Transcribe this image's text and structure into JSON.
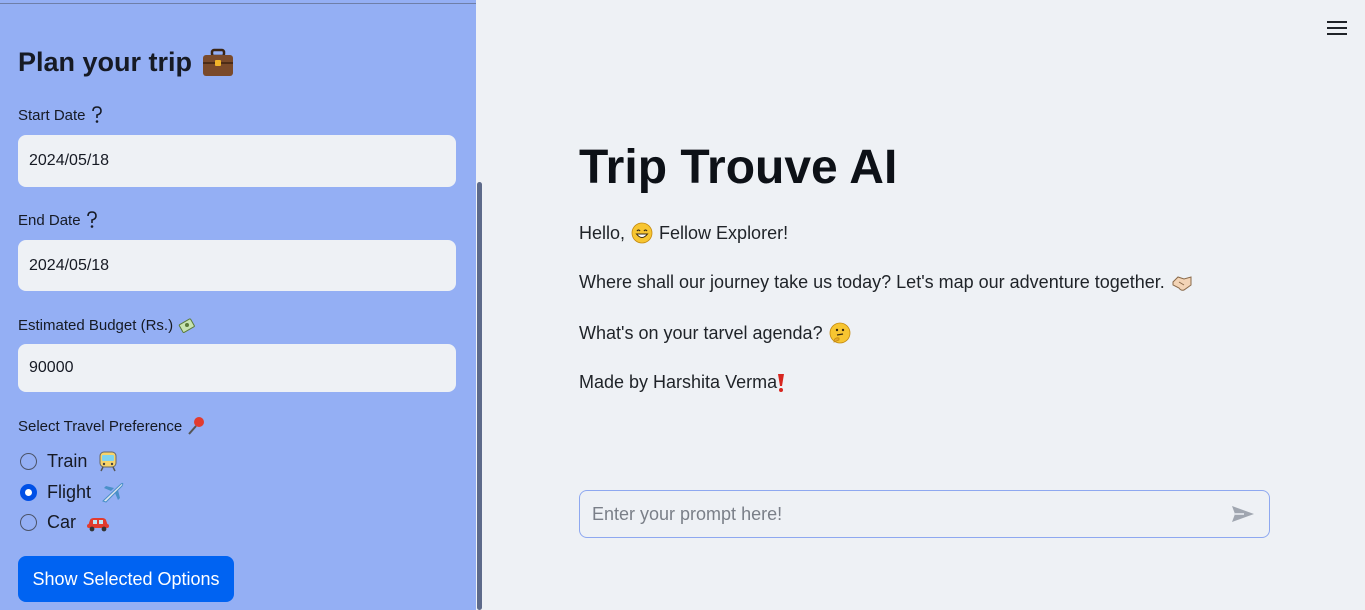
{
  "sidebar": {
    "title": "Plan your trip",
    "title_icon": "briefcase-icon",
    "start_date_label": "Start Date",
    "start_date_value": "2024/05/18",
    "end_date_label": "End Date",
    "end_date_value": "2024/05/18",
    "budget_label": "Estimated Budget (Rs.)",
    "budget_value": "90000",
    "preference_label": "Select Travel Preference",
    "options": [
      {
        "label": "Train",
        "icon": "train-icon",
        "checked": false
      },
      {
        "label": "Flight",
        "icon": "airplane-icon",
        "checked": true
      },
      {
        "label": "Car",
        "icon": "car-icon",
        "checked": false
      }
    ],
    "button_label": "Show Selected Options"
  },
  "main": {
    "title": "Trip Trouve AI",
    "greeting_pre": "Hello,",
    "greeting_post": "Fellow Explorer!",
    "line2": "Where shall our journey take us today? Let's map our adventure together.",
    "line3": "What's on your tarvel agenda?",
    "line4": "Made by Harshita Verma",
    "prompt_placeholder": "Enter your prompt here!"
  },
  "colors": {
    "sidebar_bg": "#94aff4",
    "accent": "#0063f2",
    "main_bg": "#eef1f5"
  }
}
